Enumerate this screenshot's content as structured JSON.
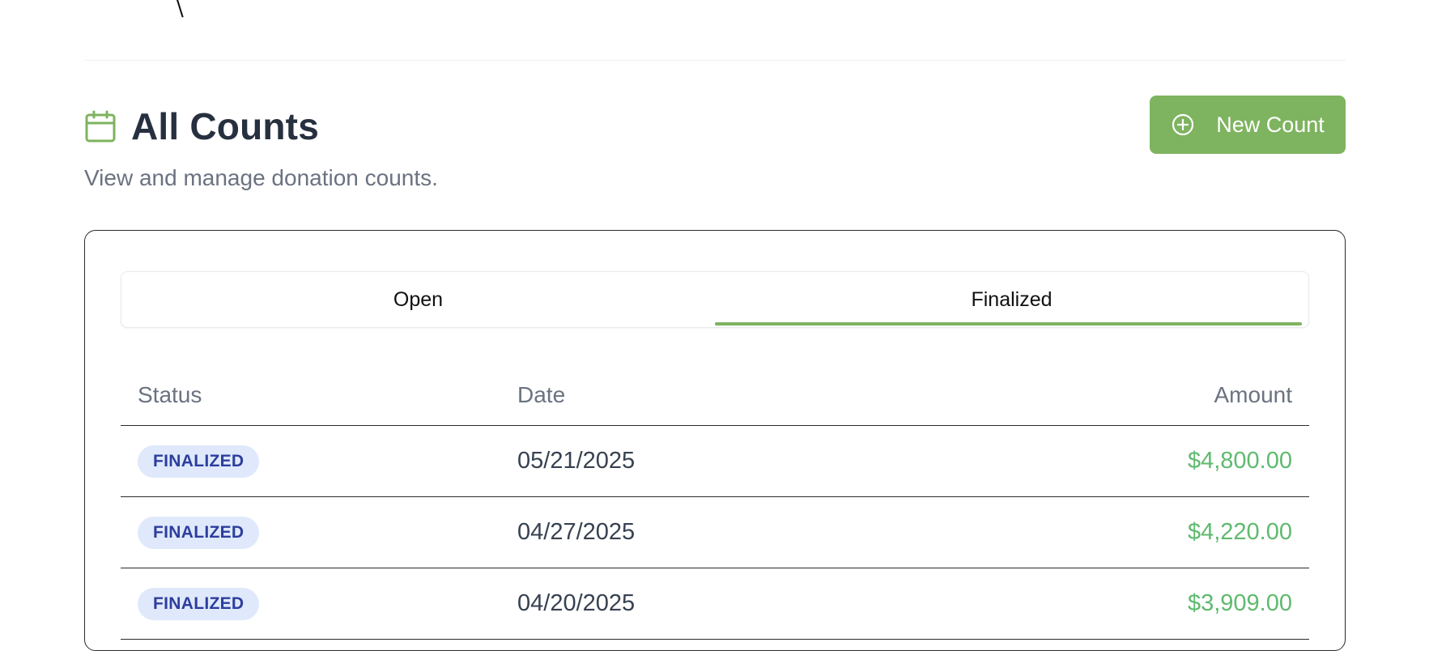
{
  "header": {
    "title": "All Counts",
    "subtitle": "View and manage donation counts.",
    "icon": "calendar-icon",
    "new_button_label": "New Count",
    "new_button_icon": "plus-circle-icon"
  },
  "tabs": [
    {
      "label": "Open",
      "active": false
    },
    {
      "label": "Finalized",
      "active": true
    }
  ],
  "table": {
    "columns": [
      "Status",
      "Date",
      "Amount"
    ],
    "rows": [
      {
        "status": "FINALIZED",
        "date": "05/21/2025",
        "amount": "$4,800.00"
      },
      {
        "status": "FINALIZED",
        "date": "04/27/2025",
        "amount": "$4,220.00"
      },
      {
        "status": "FINALIZED",
        "date": "04/20/2025",
        "amount": "$3,909.00"
      }
    ]
  },
  "colors": {
    "accent": "#7eb35f",
    "amount": "#5fba6e",
    "badge_bg": "#dfe9fb",
    "badge_text": "#2c3e9e"
  }
}
